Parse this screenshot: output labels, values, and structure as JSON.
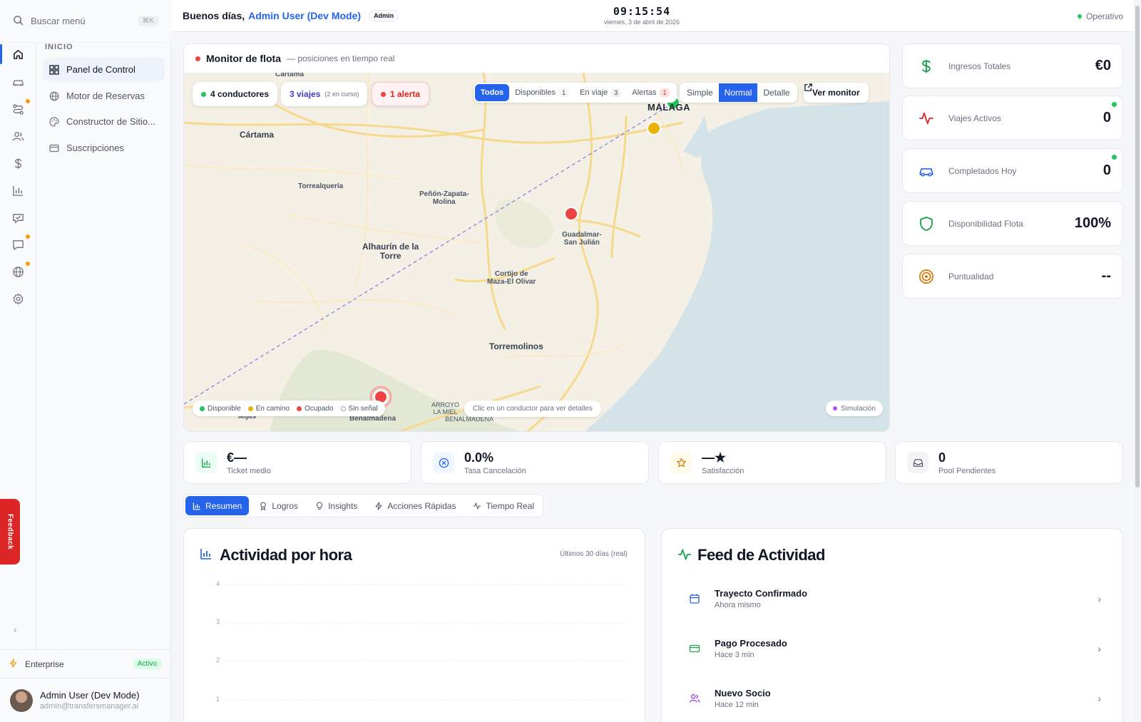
{
  "search": {
    "placeholder": "Buscar menú",
    "shortcut": "⌘K"
  },
  "rail": {
    "items": [
      {
        "icon": "home-icon",
        "active": true,
        "dot": false
      },
      {
        "icon": "car-icon",
        "active": false,
        "dot": false
      },
      {
        "icon": "route-icon",
        "active": false,
        "dot": true
      },
      {
        "icon": "users-icon",
        "active": false,
        "dot": false
      },
      {
        "icon": "dollar-icon",
        "active": false,
        "dot": false
      },
      {
        "icon": "bar-chart-icon",
        "active": false,
        "dot": false
      },
      {
        "icon": "badge-icon",
        "active": false,
        "dot": false
      },
      {
        "icon": "message-icon",
        "active": false,
        "dot": true
      },
      {
        "icon": "globe-icon",
        "active": false,
        "dot": true
      },
      {
        "icon": "gear-icon",
        "active": false,
        "dot": false
      }
    ]
  },
  "nav": {
    "section": "INICIO",
    "items": [
      {
        "label": "Panel de Control",
        "icon": "grid-icon",
        "active": true
      },
      {
        "label": "Motor de Reservas",
        "icon": "globe-icon",
        "active": false
      },
      {
        "label": "Constructor de Sitio...",
        "icon": "palette-icon",
        "active": false
      },
      {
        "label": "Suscripciones",
        "icon": "card-icon",
        "active": false
      }
    ]
  },
  "plan": {
    "name": "Enterprise",
    "status": "Activo"
  },
  "user": {
    "name": "Admin User (Dev Mode)",
    "email": "admin@transfersmanager.ai"
  },
  "feedback": "Feedback",
  "header": {
    "greeting": "Buenos días,",
    "user_name": "Admin User (Dev Mode)",
    "role": "Admin",
    "time": "09:15:54",
    "date": "viernes, 3 de abril de 2026",
    "status": "Operativo"
  },
  "fleet": {
    "title": "Monitor de flota",
    "subtitle": "— posiciones en tiempo real",
    "drivers": "4 conductores",
    "trips": "3 viajes",
    "trips_sub": "(2 en curso)",
    "alerts": "1 alerta",
    "filters": [
      {
        "label": "Todos",
        "count": "",
        "active": true
      },
      {
        "label": "Disponibles",
        "count": "1",
        "active": false
      },
      {
        "label": "En viaje",
        "count": "3",
        "active": false
      },
      {
        "label": "Alertas",
        "count": "1",
        "active": false
      }
    ],
    "modes": [
      {
        "label": "Simple",
        "active": false
      },
      {
        "label": "Normal",
        "active": true
      },
      {
        "label": "Detalle",
        "active": false
      }
    ],
    "open_monitor": "Ver monitor",
    "legend": [
      {
        "label": "Disponible",
        "color": "#22c55e"
      },
      {
        "label": "En camino",
        "color": "#eab308"
      },
      {
        "label": "Ocupado",
        "color": "#ef4444"
      },
      {
        "label": "Sin señal",
        "color": "#9ca3af"
      }
    ],
    "hint": "Clic en un conductor para ver detalles",
    "simulation": "Simulación",
    "places": {
      "cartama_top": "Cartama",
      "cartama": "Cártama",
      "malaga": "MÁLAGA",
      "torrealqueria": "Torrealquería",
      "penon": "Peñón-Zapata-\nMolina",
      "alhaurin": "Alhaurín de la\nTorre",
      "guadalmar": "Guadalmar-\nSan Julián",
      "cortijo": "Cortijo de\nMaza-El Olivar",
      "torremolinos": "Torremolinos",
      "mijas": "Mijas",
      "benalmadena": "Benalmádena",
      "arroyo": "ARROYO\nLA MIEL",
      "benalmadena2": "BENALMÁDENA"
    }
  },
  "stats": [
    {
      "label": "Ingresos Totales",
      "value": "€0",
      "icon": "dollar-icon",
      "color": "#16a34a",
      "dot": false
    },
    {
      "label": "Viajes Activos",
      "value": "0",
      "icon": "activity-icon",
      "color": "#dc2626",
      "dot": true
    },
    {
      "label": "Completados Hoy",
      "value": "0",
      "icon": "car-icon",
      "color": "#2563eb",
      "dot": true
    },
    {
      "label": "Disponibilidad Flota",
      "value": "100%",
      "icon": "shield-icon",
      "color": "#16a34a",
      "dot": false
    },
    {
      "label": "Puntualidad",
      "value": "--",
      "icon": "target-icon",
      "color": "#d97706",
      "dot": false
    }
  ],
  "kpis": [
    {
      "value": "€—",
      "label": "Ticket medio",
      "icon": "bar-chart-icon"
    },
    {
      "value": "0.0%",
      "label": "Tasa Cancelación",
      "icon": "x-circle-icon"
    },
    {
      "value": "—★",
      "label": "Satisfacción",
      "icon": "star-icon"
    },
    {
      "value": "0",
      "label": "Pool Pendientes",
      "icon": "inbox-icon"
    }
  ],
  "tabs": [
    {
      "label": "Resumen",
      "icon": "bar-chart-icon",
      "active": true
    },
    {
      "label": "Logros",
      "icon": "award-icon",
      "active": false
    },
    {
      "label": "Insights",
      "icon": "bulb-icon",
      "active": false
    },
    {
      "label": "Acciones Rápidas",
      "icon": "bolt-icon",
      "active": false
    },
    {
      "label": "Tiempo Real",
      "icon": "activity-icon",
      "active": false
    }
  ],
  "activity": {
    "title": "Actividad por hora",
    "range": "Últimos 30 días (real)",
    "y_ticks": [
      "4",
      "3",
      "2",
      "1"
    ]
  },
  "feed": {
    "title": "Feed de Actividad",
    "items": [
      {
        "title": "Trayecto Confirmado",
        "time": "Ahora mismo",
        "icon": "calendar-icon",
        "color": "#2563eb"
      },
      {
        "title": "Pago Procesado",
        "time": "Hace 3 min",
        "icon": "card-icon",
        "color": "#16a34a"
      },
      {
        "title": "Nuevo Socio",
        "time": "Hace 12 min",
        "icon": "users-icon",
        "color": "#9333ea"
      }
    ]
  }
}
